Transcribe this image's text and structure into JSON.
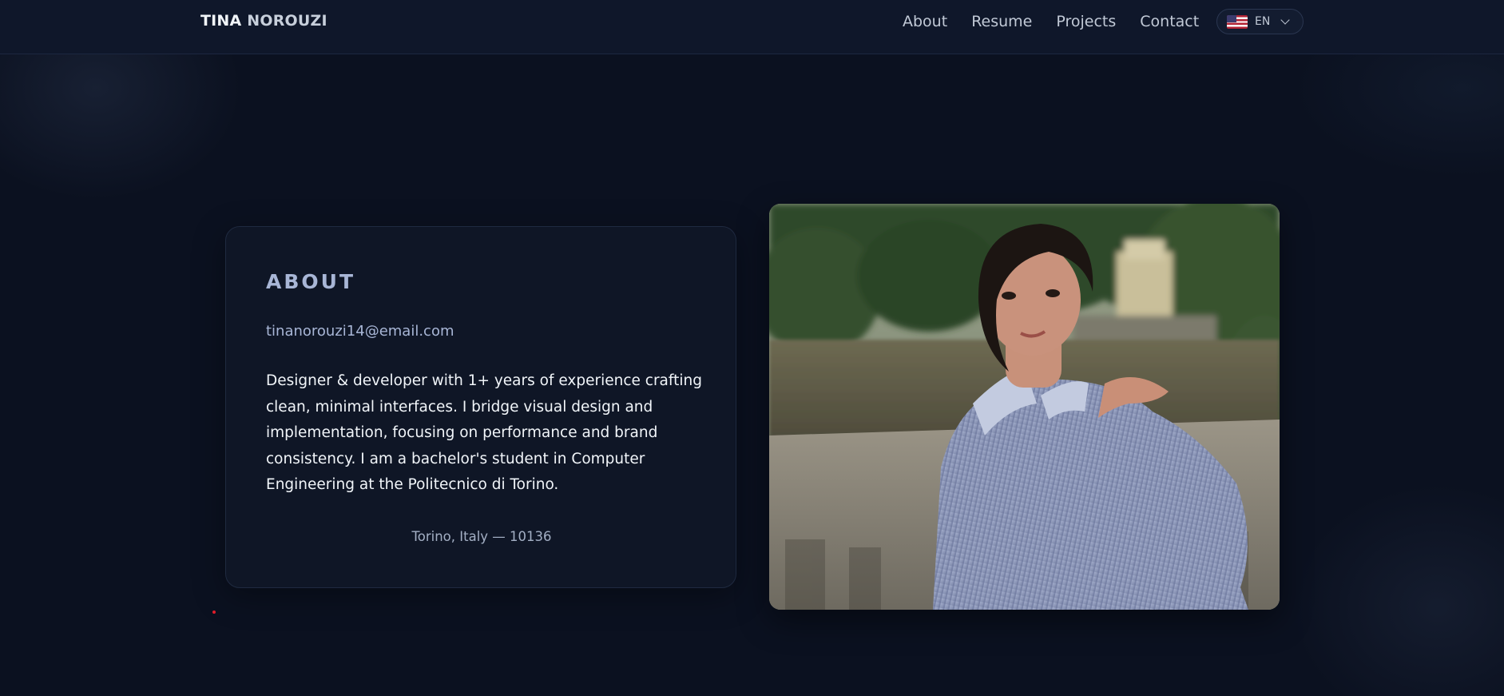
{
  "header": {
    "brand_first": "TINA",
    "brand_last": "NOROUZI",
    "nav": [
      "About",
      "Resume",
      "Projects",
      "Contact"
    ],
    "language": {
      "code": "EN",
      "flag_icon": "us-flag-icon"
    }
  },
  "about": {
    "title": "ABOUT",
    "email": "tinanorouzi14@email.com",
    "bio": "Designer & developer with 1+ years of experience crafting clean, minimal interfaces. I bridge visual design and implementation, focusing on performance and brand consistency. I am a bachelor's student in Computer Engineering at the Politecnico di Torino.",
    "location": "Torino, Italy — 10136"
  },
  "photo": {
    "subject": "portrait-photo"
  },
  "colors": {
    "background": "#0b1120",
    "header": "#0f172a",
    "card": "#0f1626",
    "accent_text": "#a8b6d6",
    "body_text": "#f1f5f9"
  }
}
